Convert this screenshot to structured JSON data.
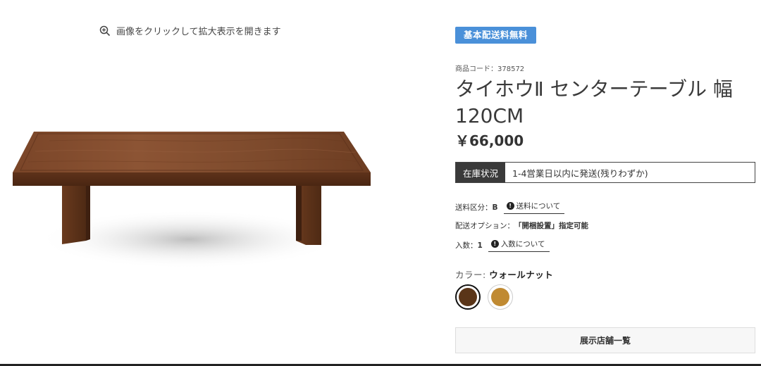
{
  "gallery": {
    "zoom_hint": "画像をクリックして拡大表示を開きます",
    "zoom_icon": "zoom-in-icon"
  },
  "product": {
    "badge": "基本配送料無料",
    "code_label": "商品コード：",
    "code_value": "378572",
    "title": "タイホウⅡ センターテーブル 幅120CM",
    "price": "￥66,000",
    "stock": {
      "label": "在庫状況",
      "value": "1-4営業日以内に発送(残りわずか)"
    },
    "shipping": {
      "label": "送料区分：",
      "value": "B",
      "link": "送料について"
    },
    "delivery": {
      "label": "配送オプション：",
      "value": "「開梱設置」指定可能"
    },
    "quantity": {
      "label": "入数：",
      "value": "1",
      "link": "入数について"
    },
    "color": {
      "label": "カラー: ",
      "selected": "ウォールナット",
      "swatches": [
        "#5a3518",
        "#c08a32"
      ]
    },
    "store_button": "展示店舗一覧"
  },
  "colors": {
    "badge": "#4a90d9",
    "stock_label_bg": "#3a3a3a"
  }
}
